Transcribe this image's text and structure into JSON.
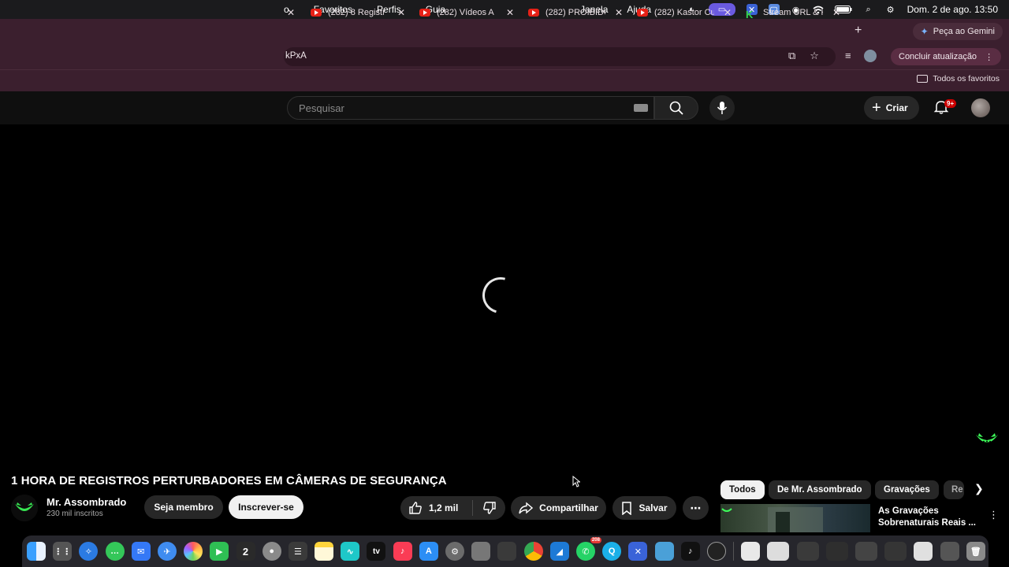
{
  "menubar": {
    "app_fragment": "o",
    "menus": [
      "Favoritos",
      "Perfis",
      "Guia"
    ],
    "right_menus": [
      "Janela",
      "Ajuda"
    ],
    "clock": "Dom. 2 de ago.  13:50"
  },
  "tabs": [
    {
      "title": "(282) 8 Registr",
      "icon": "youtube-icon"
    },
    {
      "title": "(282) Vídeos A",
      "icon": "youtube-icon"
    },
    {
      "title": "(282) PROIBIDO",
      "icon": "youtube-icon"
    },
    {
      "title": "(282) Kastor Cu",
      "icon": "youtube-icon"
    },
    {
      "title": "Stream URL & K",
      "icon": "kick-icon"
    }
  ],
  "gemini": {
    "label": "Peça ao Gemini"
  },
  "address": {
    "url": "kPxA"
  },
  "update_label": "Concluir atualização",
  "bookmarks": {
    "all_label": "Todos os favoritos"
  },
  "youtube": {
    "search_placeholder": "Pesquisar",
    "create_label": "Criar",
    "notification_badge": "9+"
  },
  "video": {
    "title": "1 HORA DE REGISTROS PERTURBADORES EM CÂMERAS DE SEGURANÇA",
    "channel": "Mr. Assombrado",
    "subscribers": "230 mil inscritos",
    "member_label": "Seja membro",
    "subscribe_label": "Inscrever-se",
    "likes": "1,2 mil",
    "share_label": "Compartilhar",
    "save_label": "Salvar",
    "more_label": "⋯"
  },
  "chips": [
    "Todos",
    "De Mr. Assombrado",
    "Gravações",
    "Re"
  ],
  "recommendation": {
    "title_line1": "As Gravações",
    "title_line2": "Sobrenaturais Reais ..."
  },
  "dock": {
    "whatsapp_badge": "208",
    "calendar_day": "2",
    "tv_label": "tv"
  },
  "colors": {
    "browser_frame": "#3b1f2e",
    "youtube_bg": "#0f0f0f",
    "youtube_red": "#e62117",
    "chip_active": "#f1f1f1"
  }
}
